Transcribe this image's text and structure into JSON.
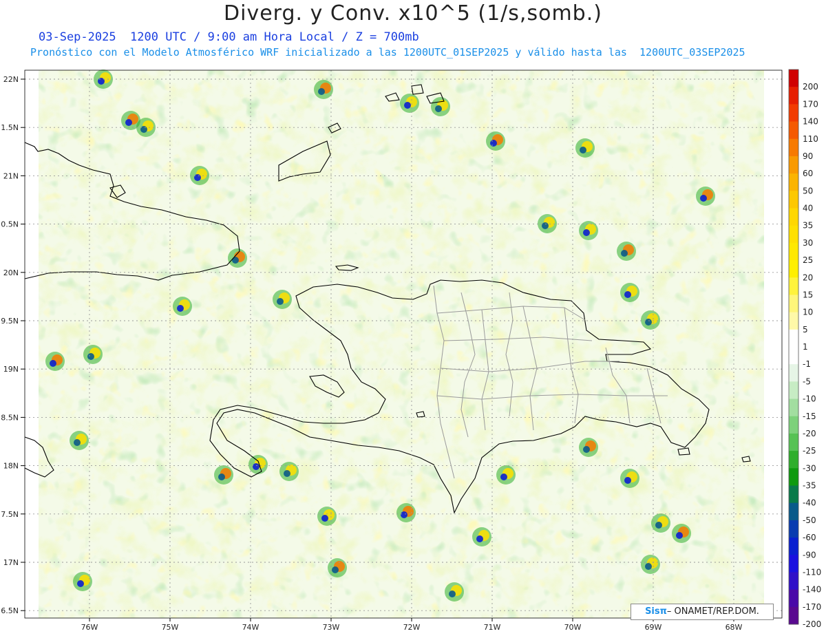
{
  "header": {
    "title": "Diverg. y Conv. x10^5 (1/s,somb.)",
    "line1": "03-Sep-2025  1200 UTC / 9:00 am Hora Local / Z = 700mb",
    "line2": "Pronóstico con el Modelo Atmosférico WRF inicializado a las 1200UTC_01SEP2025 y válido hasta las  1200UTC_03SEP2025"
  },
  "axes": {
    "lat_labels": [
      "22N",
      "1.5N",
      "21N",
      "0.5N",
      "20N",
      "9.5N",
      "19N",
      "8.5N",
      "18N",
      "7.5N",
      "17N",
      "6.5N"
    ],
    "lon_labels": [
      "76W",
      "75W",
      "74W",
      "73W",
      "72W",
      "71W",
      "70W",
      "69W",
      "68W"
    ]
  },
  "colorbar": {
    "labels": [
      "200",
      "170",
      "140",
      "110",
      "90",
      "60",
      "50",
      "40",
      "35",
      "30",
      "25",
      "20",
      "15",
      "10",
      "5",
      "1",
      "-1",
      "-5",
      "-10",
      "-15",
      "-20",
      "-25",
      "-30",
      "-35",
      "-40",
      "-50",
      "-60",
      "-90",
      "-110",
      "-140",
      "-170",
      "-200"
    ],
    "colors": [
      "#d00000",
      "#e61f00",
      "#f23c00",
      "#f55a00",
      "#f77a00",
      "#f99a00",
      "#fbb400",
      "#fdc800",
      "#ffd700",
      "#ffe000",
      "#ffe800",
      "#ffef00",
      "#fff33c",
      "#fff67a",
      "#fff9a8",
      "#ffffff",
      "#ffffff",
      "#e6f5e6",
      "#c7ecc4",
      "#a2dea0",
      "#7dd17b",
      "#56c254",
      "#2fae2c",
      "#0f9a0f",
      "#0a7a4a",
      "#0a5a8a",
      "#0a3cb0",
      "#0a20d0",
      "#1a10e0",
      "#3010c8",
      "#4a0aa8",
      "#5a0a90"
    ]
  },
  "credit": {
    "brand": "Sisπ",
    "text": "– ONAMET/REP.DOM."
  }
}
